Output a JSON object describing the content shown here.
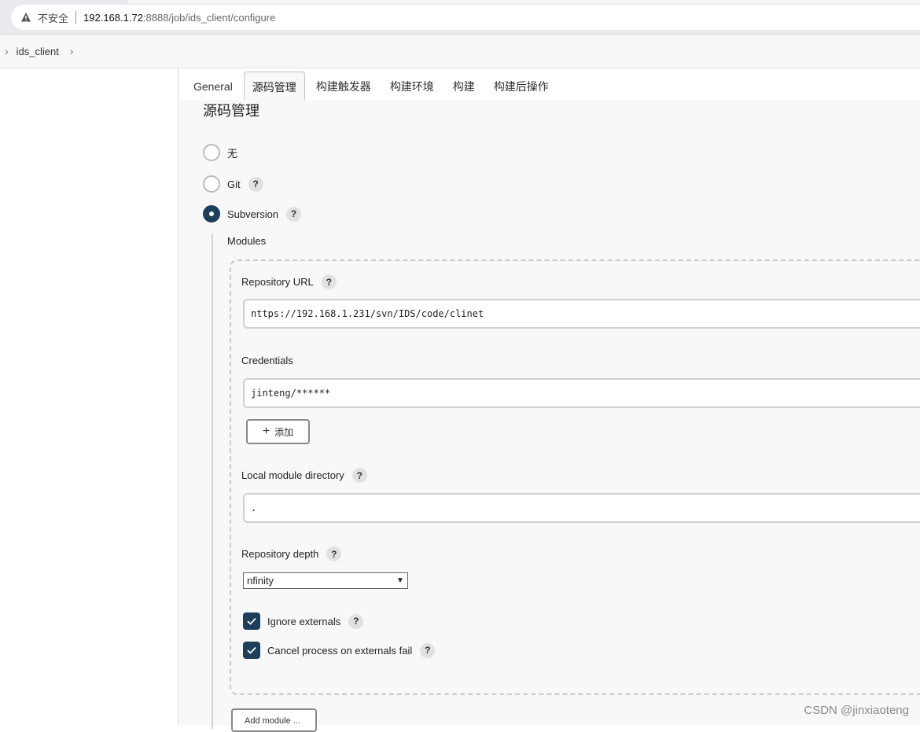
{
  "browser": {
    "insecure_label": "不安全",
    "host": "192.168.1.72",
    "path": ":8888/job/ids_client/configure"
  },
  "breadcrumb": {
    "job": "ids_client"
  },
  "tabs": [
    {
      "label": "General"
    },
    {
      "label": "源码管理"
    },
    {
      "label": "构建触发器"
    },
    {
      "label": "构建环境"
    },
    {
      "label": "构建"
    },
    {
      "label": "构建后操作"
    }
  ],
  "scm": {
    "title": "源码管理",
    "options": [
      {
        "label": "无",
        "selected": false
      },
      {
        "label": "Git",
        "selected": false
      },
      {
        "label": "Subversion",
        "selected": true
      }
    ],
    "modules_label": "Modules",
    "repository_url_label": "Repository URL",
    "repository_url_value": "nttps://192.168.1.231/svn/IDS/code/clinet",
    "credentials_label": "Credentials",
    "credentials_value": "jinteng/******",
    "add_button_label": "添加",
    "local_dir_label": "Local module directory",
    "local_dir_value": ".",
    "depth_label": "Repository depth",
    "depth_value": "nfinity",
    "ignore_externals_label": "Ignore externals",
    "cancel_process_label": "Cancel process on externals fail",
    "add_module_label": "Add module ..."
  },
  "watermark": "CSDN @jinxiaoteng"
}
